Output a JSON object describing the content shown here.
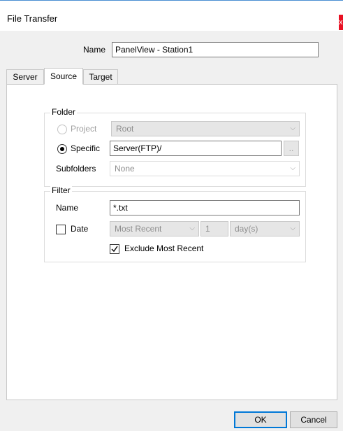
{
  "window": {
    "title": "File Transfer",
    "close_glyph": "x"
  },
  "name_label": "Name",
  "name_value": "PanelView - Station1",
  "tabs": [
    {
      "label": "Server"
    },
    {
      "label": "Source"
    },
    {
      "label": "Target"
    }
  ],
  "folder": {
    "legend": "Folder",
    "project_label": "Project",
    "project_value": "Root",
    "specific_label": "Specific",
    "specific_value": "Server(FTP)/",
    "browse_label": "..",
    "subfolders_label": "Subfolders",
    "subfolders_value": "None"
  },
  "filter": {
    "legend": "Filter",
    "name_label": "Name",
    "name_value": "*.txt",
    "date_label": "Date",
    "date_mode": "Most Recent",
    "date_count": "1",
    "date_unit": "day(s)",
    "exclude_label": "Exclude Most Recent"
  },
  "buttons": {
    "ok": "OK",
    "cancel": "Cancel"
  }
}
